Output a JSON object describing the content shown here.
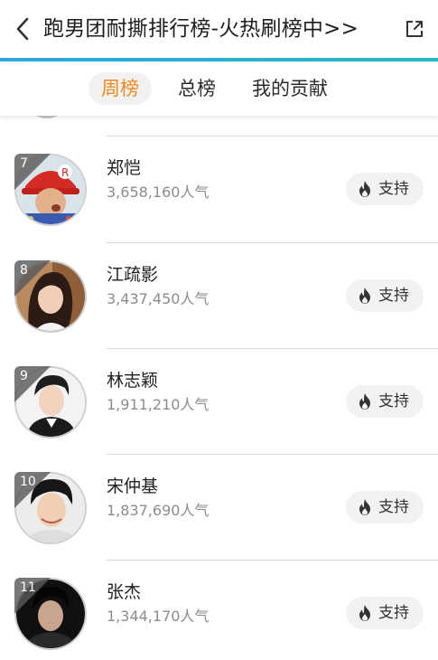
{
  "header": {
    "title": "跑男团耐撕排行榜-火热刷榜中>>",
    "back_icon": "chevron-left-icon",
    "share_icon": "share-icon",
    "accent_color": "#2ea7e0"
  },
  "tabs": [
    {
      "label": "周榜",
      "active": true
    },
    {
      "label": "总榜",
      "active": false
    },
    {
      "label": "我的贡献",
      "active": false
    }
  ],
  "active_tab_color": "#f08a1c",
  "support_label": "支持",
  "support_icon": "flame-icon",
  "ranking": [
    {
      "rank": "7",
      "name": "郑恺",
      "popularity": "3,658,160人气"
    },
    {
      "rank": "8",
      "name": "江疏影",
      "popularity": "3,437,450人气"
    },
    {
      "rank": "9",
      "name": "林志颖",
      "popularity": "1,911,210人气"
    },
    {
      "rank": "10",
      "name": "宋仲基",
      "popularity": "1,837,690人气"
    },
    {
      "rank": "11",
      "name": "张杰",
      "popularity": "1,344,170人气"
    }
  ]
}
